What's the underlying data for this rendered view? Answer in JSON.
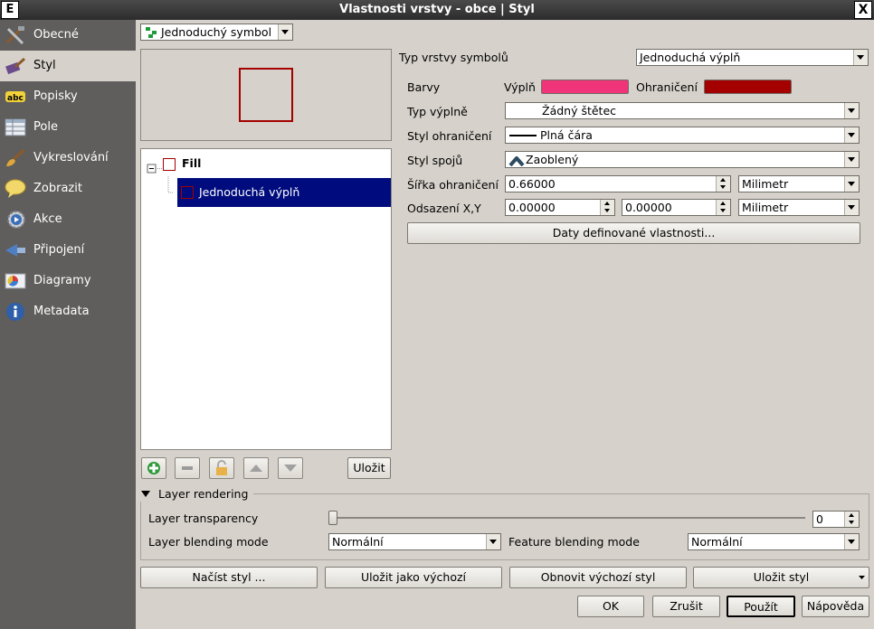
{
  "window": {
    "logo": "E",
    "title": "Vlastnosti vrstvy - obce | Styl",
    "close": "X"
  },
  "sidebar": {
    "items": [
      {
        "label": "Obecné",
        "icon": "tools-icon"
      },
      {
        "label": "Styl",
        "icon": "paintbrush-icon"
      },
      {
        "label": "Popisky",
        "icon": "abc-label-icon"
      },
      {
        "label": "Pole",
        "icon": "table-icon"
      },
      {
        "label": "Vykreslování",
        "icon": "brush-icon"
      },
      {
        "label": "Zobrazit",
        "icon": "speech-bubble-icon"
      },
      {
        "label": "Akce",
        "icon": "gear-play-icon"
      },
      {
        "label": "Připojení",
        "icon": "join-icon"
      },
      {
        "label": "Diagramy",
        "icon": "diagram-icon"
      },
      {
        "label": "Metadata",
        "icon": "info-icon"
      }
    ],
    "active_index": 1
  },
  "renderer_combo": "Jednoduchý symbol",
  "symbol_tree": {
    "root": "Fill",
    "child": "Jednoduchá výplň"
  },
  "layer_buttons": {
    "save": "Uložit"
  },
  "props": {
    "symbol_layer_type_label": "Typ vrstvy symbolů",
    "symbol_layer_type_value": "Jednoduchá výplň",
    "colors_label": "Barvy",
    "fill_label": "Výplň",
    "fill_color": "#f0347a",
    "outline_label": "Ohraničení",
    "outline_color": "#a40000",
    "fill_style_label": "Typ výplně",
    "fill_style_value": "Žádný štětec",
    "outline_style_label": "Styl ohraničení",
    "outline_style_value": "Plná čára",
    "join_style_label": "Styl spojů",
    "join_style_value": "Zaoblený",
    "outline_width_label": "Šířka ohraničení",
    "outline_width_value": "0.66000",
    "outline_width_unit": "Milimetr",
    "offset_label": "Odsazení X,Y",
    "offset_x": "0.00000",
    "offset_y": "0.00000",
    "offset_unit": "Milimetr",
    "data_defined_button": "Daty definované vlastnosti..."
  },
  "layer_rendering": {
    "title": "Layer rendering",
    "transparency_label": "Layer transparency",
    "transparency_value": "0",
    "transparency_fraction": 0,
    "blending_label": "Layer blending mode",
    "blending_value": "Normální",
    "feature_blending_label": "Feature blending mode",
    "feature_blending_value": "Normální"
  },
  "style_buttons": {
    "load": "Načíst styl ...",
    "save_default": "Uložit jako výchozí",
    "restore_default": "Obnovit výchozí styl",
    "save_style": "Uložit styl"
  },
  "dialog_buttons": {
    "ok": "OK",
    "cancel": "Zrušit",
    "apply": "Použít",
    "help": "Nápověda"
  }
}
